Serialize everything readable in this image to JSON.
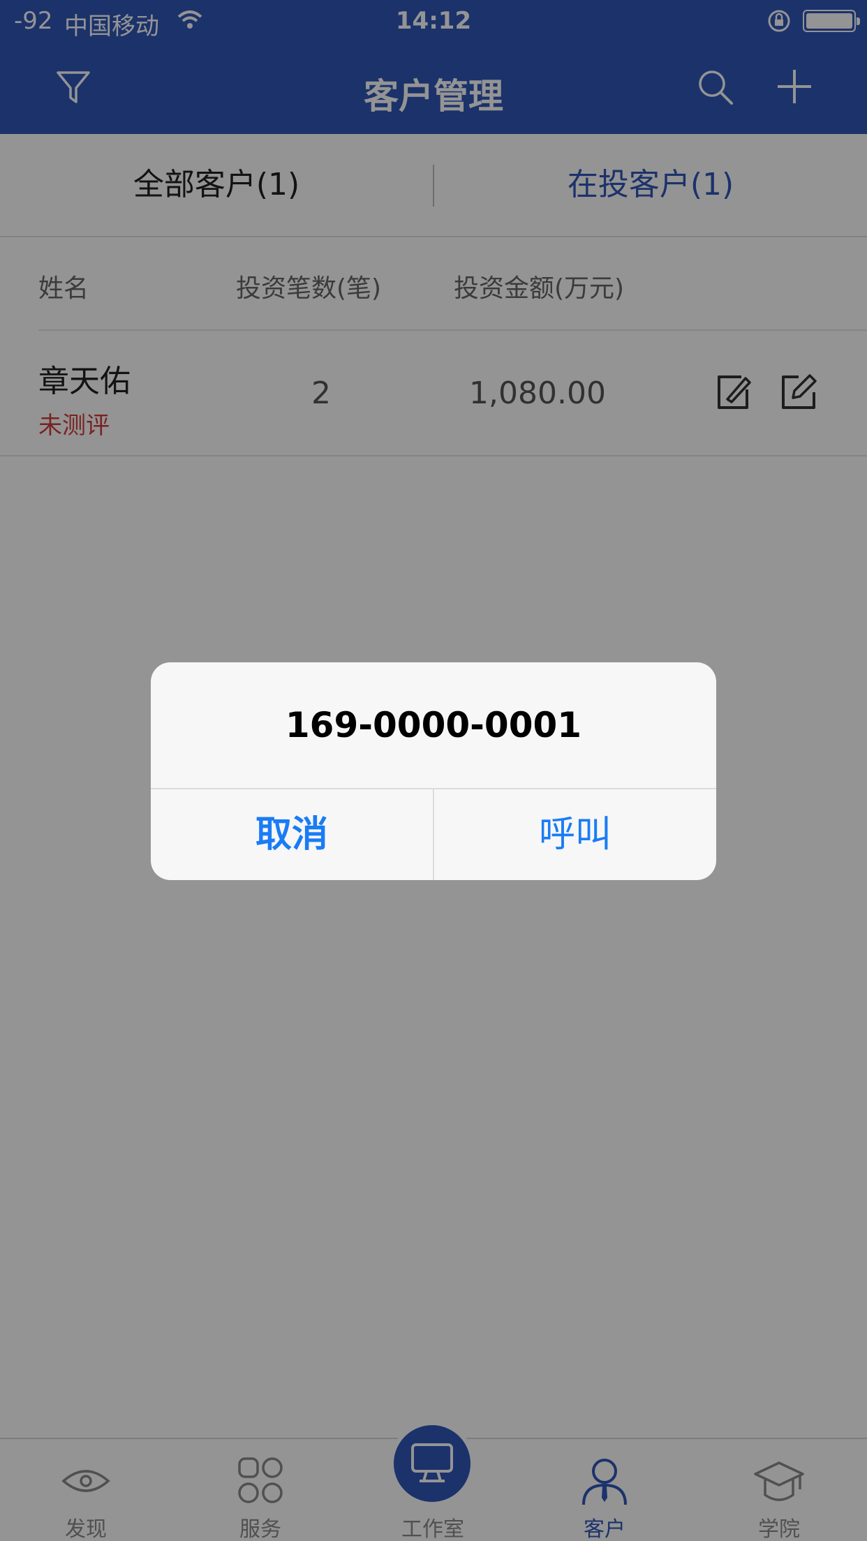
{
  "status_bar": {
    "signal": "-92",
    "carrier": "中国移动",
    "time": "14:12"
  },
  "nav": {
    "title": "客户管理"
  },
  "tabs": [
    {
      "label": "全部客户(1)",
      "active": false
    },
    {
      "label": "在投客户(1)",
      "active": true
    }
  ],
  "table": {
    "headers": [
      "姓名",
      "投资笔数(笔)",
      "投资金额(万元)"
    ],
    "rows": [
      {
        "name": "章天佑",
        "risk_status": "未测评",
        "count": "2",
        "amount": "1,080.00"
      }
    ]
  },
  "tab_bar": [
    {
      "label": "发现",
      "icon": "eye-icon",
      "active": false
    },
    {
      "label": "服务",
      "icon": "grid-icon",
      "active": false
    },
    {
      "label": "工作室",
      "icon": "monitor-icon",
      "active": false
    },
    {
      "label": "客户",
      "icon": "user-icon",
      "active": true
    },
    {
      "label": "学院",
      "icon": "graduation-cap-icon",
      "active": false
    }
  ],
  "alert": {
    "message": "169-0000-0001",
    "cancel_label": "取消",
    "call_label": "呼叫"
  },
  "colors": {
    "brand": "#2f56b8",
    "risk_red": "#d23c3c",
    "ios_blue": "#1a7cf5"
  }
}
